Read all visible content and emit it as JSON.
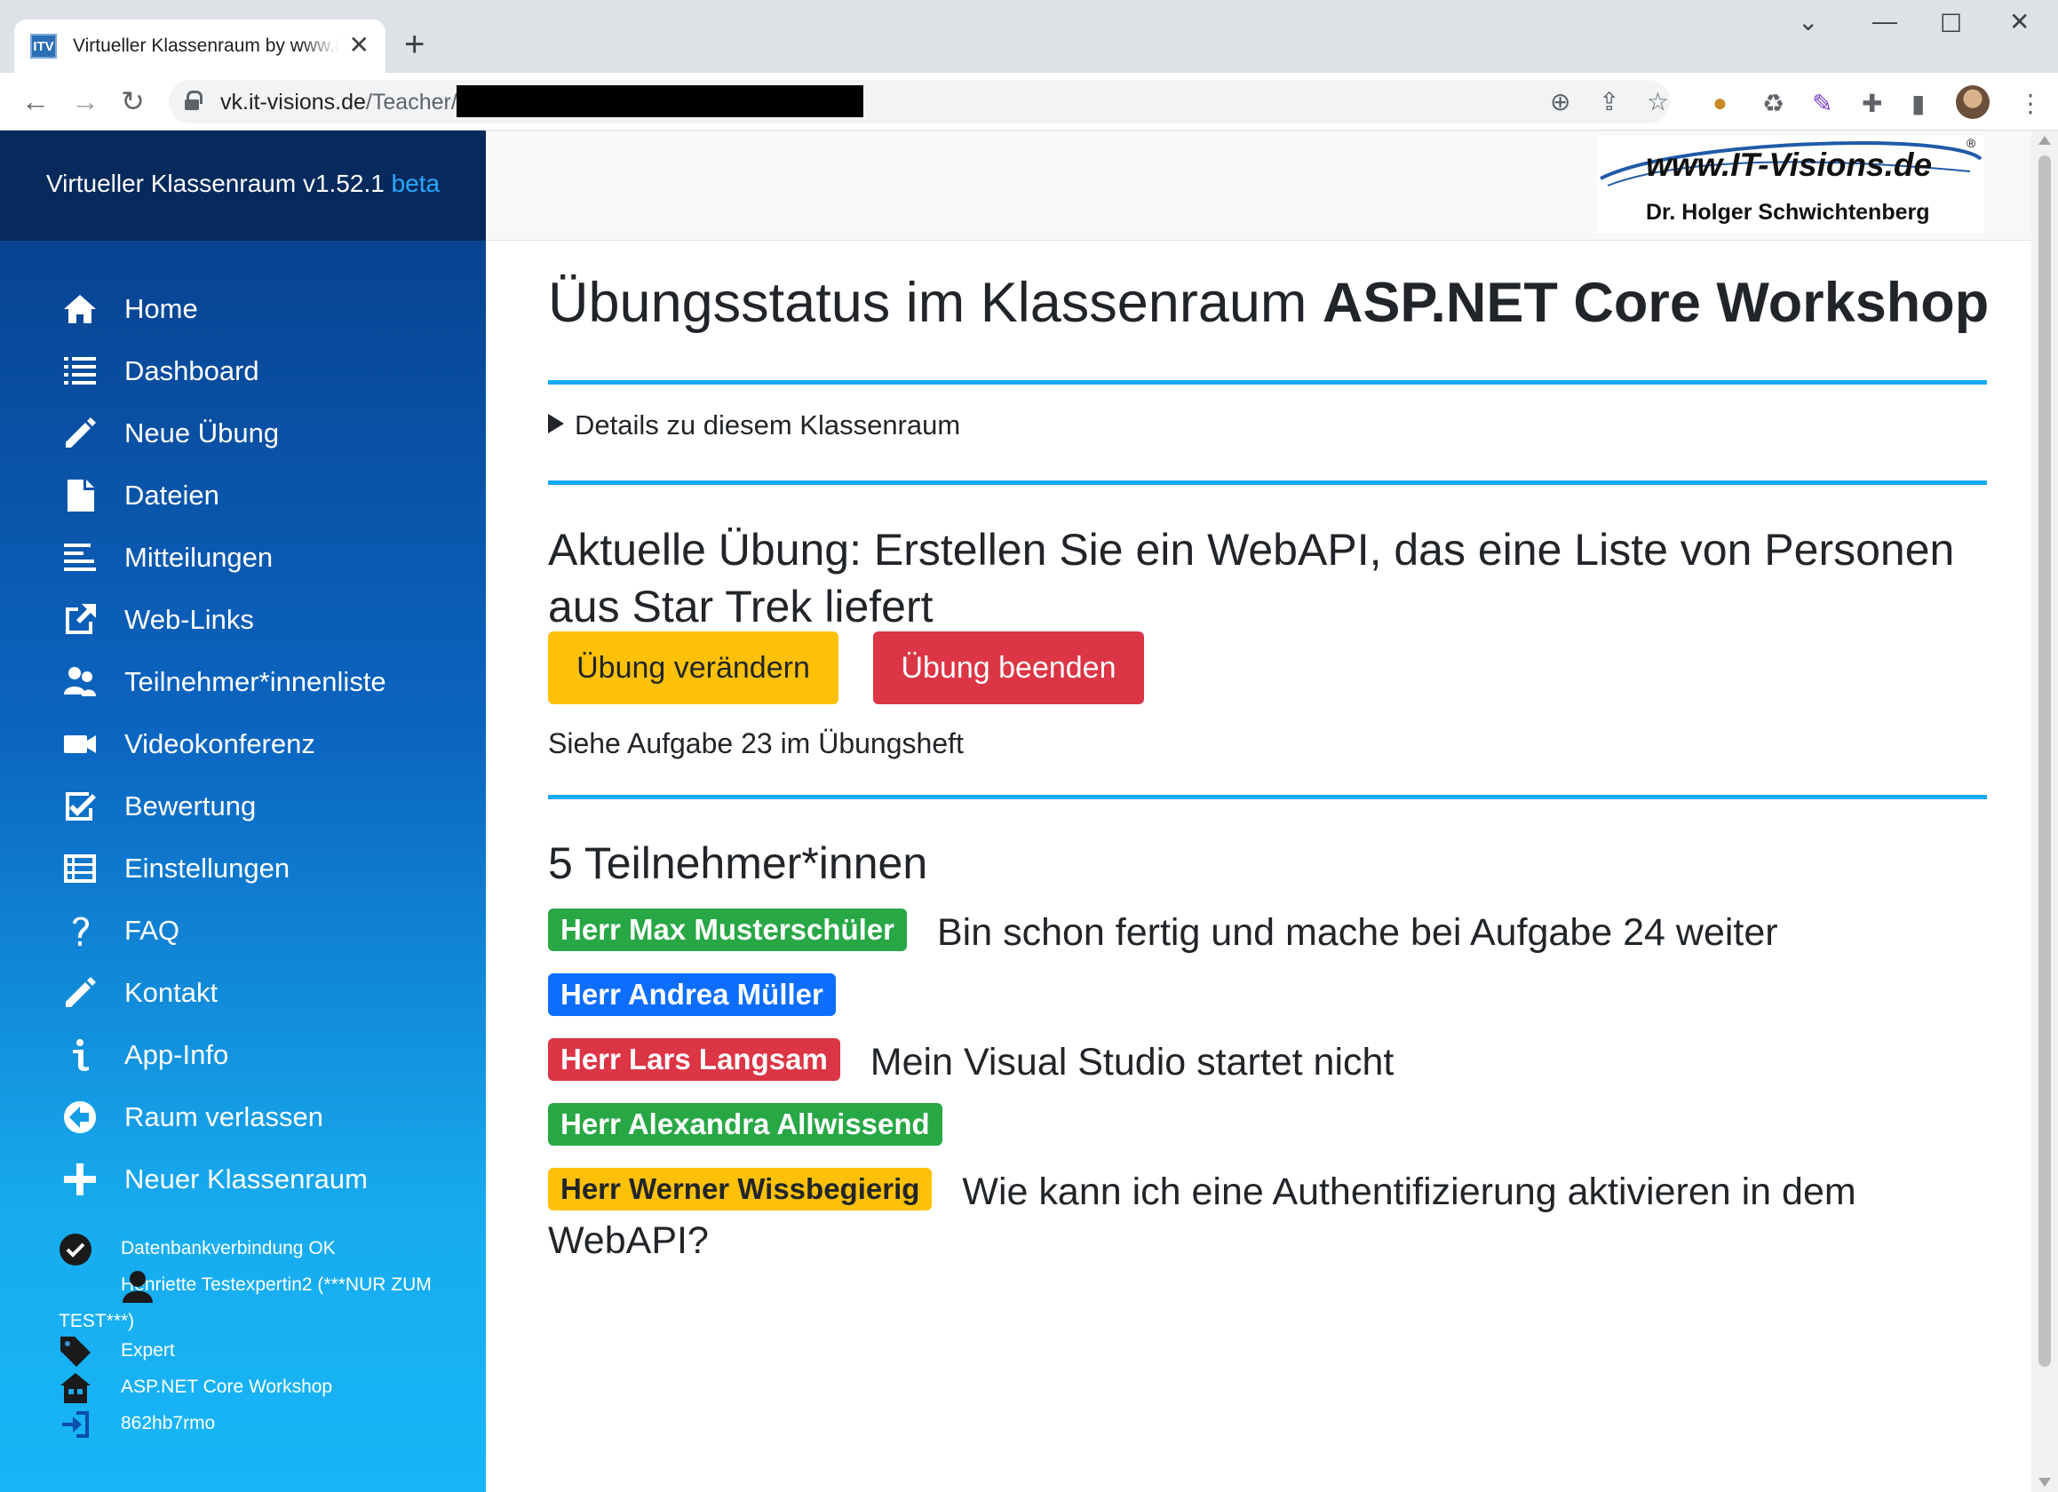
{
  "browser": {
    "tab_title": "Virtueller Klassenraum by www.IT-Visions.de",
    "tab_favicon": "ITV",
    "url_host": "vk.it-visions.de",
    "url_path": "/Teacher/c",
    "newtab_glyph": "+",
    "close_glyph": "✕"
  },
  "sidebar": {
    "brand": "Virtueller Klassenraum v1.52.1",
    "brand_beta": "beta",
    "items": [
      {
        "label": "Home",
        "icon": "home-icon"
      },
      {
        "label": "Dashboard",
        "icon": "list-icon"
      },
      {
        "label": "Neue Übung",
        "icon": "pencil-icon"
      },
      {
        "label": "Dateien",
        "icon": "file-icon"
      },
      {
        "label": "Mitteilungen",
        "icon": "text-lines-icon"
      },
      {
        "label": "Web-Links",
        "icon": "external-link-icon"
      },
      {
        "label": "Teilnehmer*innenliste",
        "icon": "people-icon"
      },
      {
        "label": "Videokonferenz",
        "icon": "video-camera-icon"
      },
      {
        "label": "Bewertung",
        "icon": "checkbox-icon"
      },
      {
        "label": "Einstellungen",
        "icon": "table-list-icon"
      },
      {
        "label": "FAQ",
        "icon": "question-icon"
      },
      {
        "label": "Kontakt",
        "icon": "pencil-icon"
      },
      {
        "label": "App-Info",
        "icon": "info-icon"
      },
      {
        "label": "Raum verlassen",
        "icon": "arrow-left-circle-icon"
      },
      {
        "label": "Neuer Klassenraum",
        "icon": "plus-icon"
      }
    ],
    "status": {
      "db": "Datenbankverbindung OK",
      "user": "Henriette Testexpertin2 (***NUR ZUM TEST***)",
      "role": "Expert",
      "room": "ASP.NET Core Workshop",
      "code": "862hb7rmo"
    }
  },
  "logo": {
    "main": "www.IT-Visions.de",
    "sub": "Dr. Holger Schwichtenberg",
    "reg": "®"
  },
  "main": {
    "title_prefix": "Übungsstatus im Klassenraum",
    "title_room": "ASP.NET Core Workshop",
    "details_label": "Details zu diesem Klassenraum",
    "exercise_label": "Aktuelle Übung: Erstellen Sie ein WebAPI, das eine Liste von Personen aus Star Trek liefert",
    "btn_change": "Übung verändern",
    "btn_end": "Übung beenden",
    "hint": "Siehe Aufgabe 23 im Übungsheft",
    "participants_title": "5 Teilnehmer*innen",
    "participants": [
      {
        "name": "Herr Max Musterschüler",
        "status": "green",
        "message": "Bin schon fertig und mache bei Aufgabe 24 weiter"
      },
      {
        "name": "Herr Andrea Müller",
        "status": "blue",
        "message": ""
      },
      {
        "name": "Herr Lars Langsam",
        "status": "red",
        "message": "Mein Visual Studio startet nicht"
      },
      {
        "name": "Herr Alexandra Allwissend",
        "status": "green",
        "message": ""
      },
      {
        "name": "Herr Werner Wissbegierig",
        "status": "yellow",
        "message": "Wie kann ich eine Authentifizierung aktivieren in dem WebAPI?"
      }
    ]
  },
  "colors": {
    "accent": "#17aaf4",
    "warning": "#ffc107",
    "danger": "#dc3545",
    "success": "#28a745",
    "primary": "#0d6efd",
    "sidebar_top": "#062a5c"
  }
}
